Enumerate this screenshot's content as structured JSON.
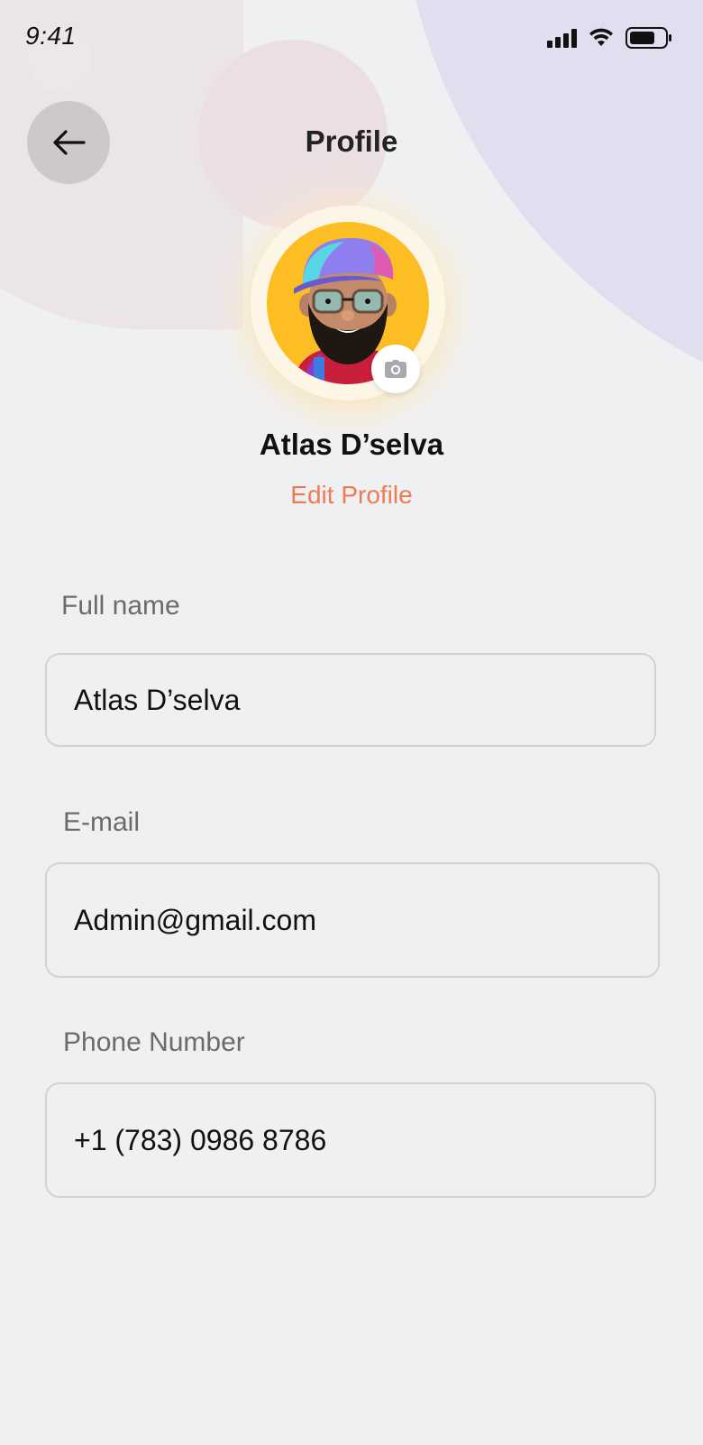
{
  "status_bar": {
    "time": "9:41",
    "icons": [
      "signal-icon",
      "wifi-icon",
      "battery-icon"
    ]
  },
  "header": {
    "back_icon": "arrow-left-icon",
    "title": "Profile"
  },
  "profile": {
    "avatar_icon": "avatar-3d-character",
    "camera_icon": "camera-icon",
    "name": "Atlas D’selva",
    "edit_label": "Edit Profile"
  },
  "form": {
    "full_name": {
      "label": "Full name",
      "value": "Atlas D’selva"
    },
    "email": {
      "label": "E-mail",
      "value": "Admin@gmail.com"
    },
    "phone": {
      "label": "Phone Number",
      "value": "+1 (783) 0986 8786"
    }
  },
  "colors": {
    "background": "#eff0f2",
    "accent": "#f07a55",
    "avatar_bg": "#fcbe23",
    "back_button_bg": "#cfc8cb"
  }
}
